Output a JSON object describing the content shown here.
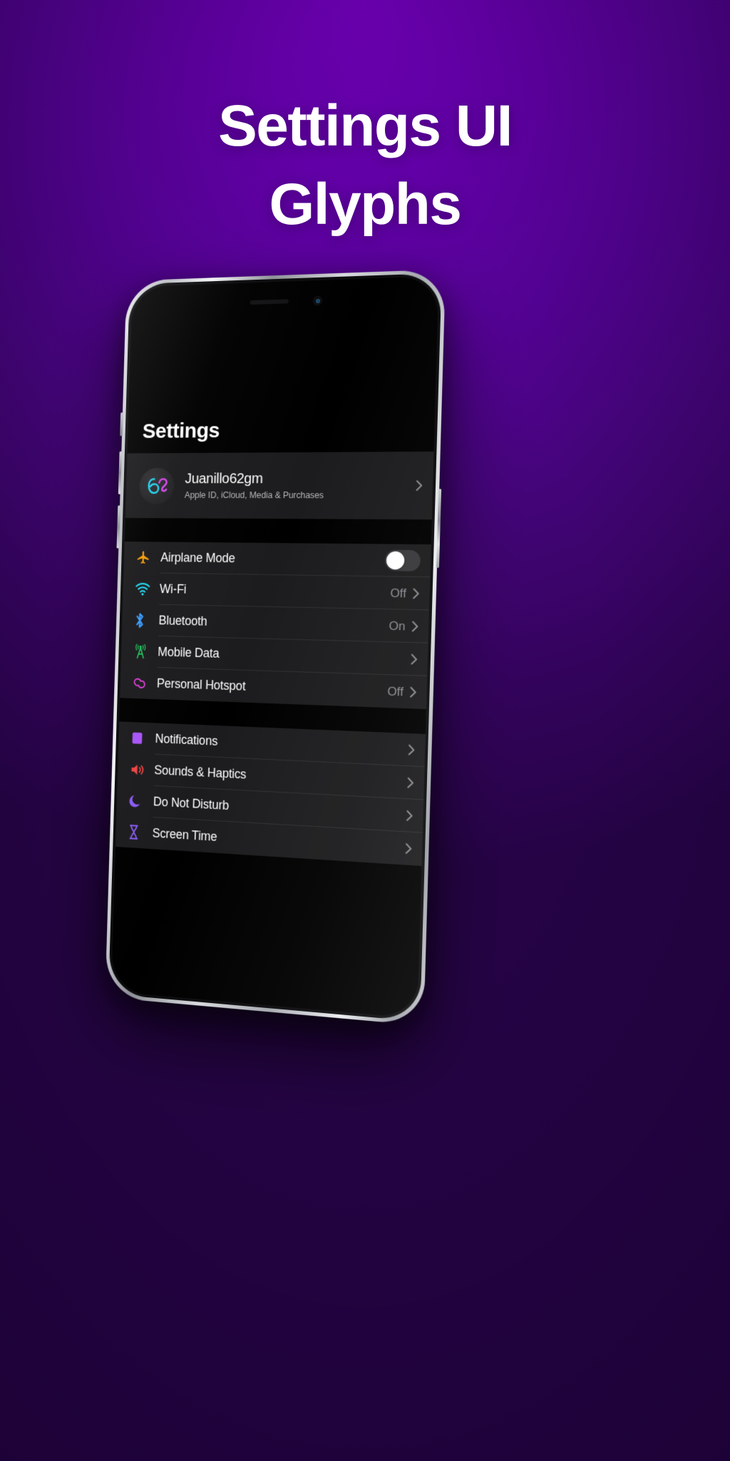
{
  "poster": {
    "title_line1": "Settings UI",
    "title_line2": "Glyphs",
    "background_top_color": "#7a00c8",
    "background_bottom_color": "#250345",
    "title_color": "#ffffff"
  },
  "phone": {
    "screen_title": "Settings",
    "account": {
      "avatar_text": "62",
      "avatar_color_left": "#22d3ee",
      "avatar_color_right": "#d946ef",
      "name": "Juanillo62gm",
      "subtitle": "Apple ID, iCloud, Media & Purchases",
      "chevron": "chevron-right"
    },
    "groups": [
      {
        "id": "connectivity",
        "rows": [
          {
            "icon": "airplane-icon",
            "icon_color": "#f59e0b",
            "label": "Airplane Mode",
            "value": "",
            "control": "toggle",
            "toggle_on": false,
            "toggle_track_color": "#3a3a3c",
            "toggle_knob_color": "#ffffff"
          },
          {
            "icon": "wifi-icon",
            "icon_color": "#22d3ee",
            "label": "Wi-Fi",
            "value": "Off",
            "control": "chevron"
          },
          {
            "icon": "bluetooth-icon",
            "icon_color": "#3b9dff",
            "label": "Bluetooth",
            "value": "On",
            "control": "chevron"
          },
          {
            "icon": "cellular-antenna-icon",
            "icon_color": "#22c55e",
            "label": "Mobile Data",
            "value": "",
            "control": "chevron"
          },
          {
            "icon": "personal-hotspot-icon",
            "icon_color": "#e040d8",
            "label": "Personal Hotspot",
            "value": "Off",
            "control": "chevron"
          }
        ]
      },
      {
        "id": "alerts",
        "rows": [
          {
            "icon": "notifications-icon",
            "icon_color": "#a855f7",
            "label": "Notifications",
            "value": "",
            "control": "chevron"
          },
          {
            "icon": "speaker-waves-icon",
            "icon_color": "#ef4444",
            "label": "Sounds & Haptics",
            "value": "",
            "control": "chevron"
          },
          {
            "icon": "moon-icon",
            "icon_color": "#8b5cf6",
            "label": "Do Not Disturb",
            "value": "",
            "control": "chevron"
          },
          {
            "icon": "hourglass-icon",
            "icon_color": "#8b5cf6",
            "label": "Screen Time",
            "value": "",
            "control": "chevron"
          }
        ]
      }
    ]
  }
}
